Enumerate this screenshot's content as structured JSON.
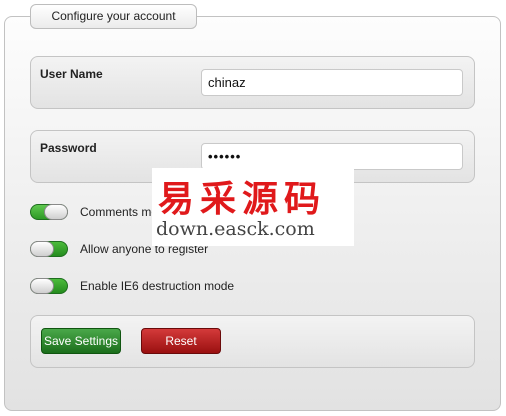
{
  "panel": {
    "title": "Configure your account"
  },
  "fields": {
    "username": {
      "label": "User Name",
      "value": "chinaz"
    },
    "password": {
      "label": "Password",
      "value": "••••••"
    }
  },
  "toggles": [
    {
      "label": "Comments moderation",
      "state": "on"
    },
    {
      "label": "Allow anyone to register",
      "state": "on"
    },
    {
      "label": "Enable IE6 destruction mode",
      "state": "on"
    }
  ],
  "actions": {
    "save_label": "Save Settings",
    "reset_label": "Reset"
  },
  "watermark": {
    "text": "易采源码",
    "url": "down.easck.com"
  },
  "colors": {
    "toggle_on": "#3aa82e",
    "save_button": "#1b6e1b",
    "reset_button": "#b01818",
    "watermark_red": "#e0191b"
  }
}
